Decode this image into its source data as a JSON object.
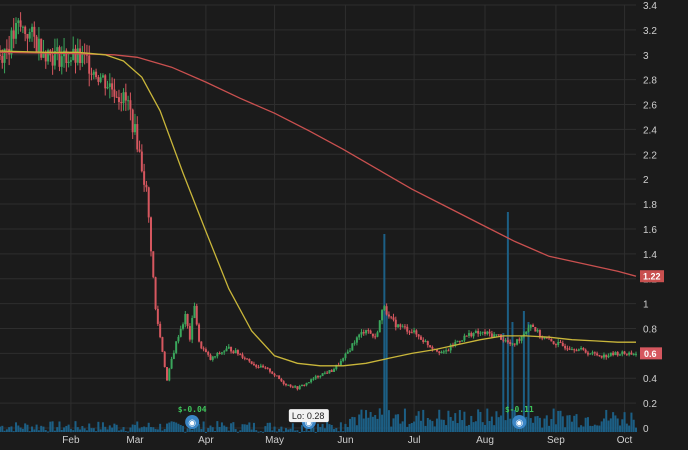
{
  "chart_data": {
    "type": "candlestick",
    "title": "",
    "xlabel": "",
    "ylabel": "",
    "ylim": [
      0,
      3.4
    ],
    "y_ticks": [
      0,
      0.2,
      0.4,
      0.6,
      0.8,
      1,
      1.2,
      1.4,
      1.6,
      1.8,
      2,
      2.2,
      2.4,
      2.6,
      2.8,
      3,
      3.2,
      3.4
    ],
    "x_range_days": [
      0,
      278
    ],
    "month_labels": [
      {
        "label": "Feb",
        "day": 31
      },
      {
        "label": "Mar",
        "day": 59
      },
      {
        "label": "Apr",
        "day": 90
      },
      {
        "label": "May",
        "day": 120
      },
      {
        "label": "Jun",
        "day": 151
      },
      {
        "label": "Jul",
        "day": 181
      },
      {
        "label": "Aug",
        "day": 212
      },
      {
        "label": "Sep",
        "day": 243
      },
      {
        "label": "Oct",
        "day": 273
      }
    ],
    "close_anchors": [
      [
        0,
        3.0
      ],
      [
        4,
        3.08
      ],
      [
        8,
        3.22
      ],
      [
        12,
        3.18
      ],
      [
        16,
        3.1
      ],
      [
        22,
        3.0
      ],
      [
        30,
        2.98
      ],
      [
        38,
        2.95
      ],
      [
        44,
        2.82
      ],
      [
        50,
        2.72
      ],
      [
        56,
        2.6
      ],
      [
        60,
        2.3
      ],
      [
        64,
        1.9
      ],
      [
        66,
        1.45
      ],
      [
        68,
        0.95
      ],
      [
        71,
        0.62
      ],
      [
        73,
        0.38
      ],
      [
        75,
        0.55
      ],
      [
        78,
        0.75
      ],
      [
        81,
        0.9
      ],
      [
        83,
        0.72
      ],
      [
        85,
        1.0
      ],
      [
        87,
        0.68
      ],
      [
        92,
        0.55
      ],
      [
        96,
        0.6
      ],
      [
        100,
        0.64
      ],
      [
        106,
        0.58
      ],
      [
        112,
        0.5
      ],
      [
        118,
        0.46
      ],
      [
        124,
        0.36
      ],
      [
        130,
        0.32
      ],
      [
        134,
        0.36
      ],
      [
        140,
        0.43
      ],
      [
        145,
        0.46
      ],
      [
        150,
        0.55
      ],
      [
        155,
        0.7
      ],
      [
        160,
        0.8
      ],
      [
        164,
        0.72
      ],
      [
        168,
        1.0
      ],
      [
        170,
        0.88
      ],
      [
        174,
        0.82
      ],
      [
        180,
        0.78
      ],
      [
        188,
        0.66
      ],
      [
        194,
        0.6
      ],
      [
        200,
        0.7
      ],
      [
        206,
        0.76
      ],
      [
        212,
        0.76
      ],
      [
        218,
        0.74
      ],
      [
        224,
        0.66
      ],
      [
        228,
        0.74
      ],
      [
        232,
        0.84
      ],
      [
        236,
        0.74
      ],
      [
        240,
        0.7
      ],
      [
        246,
        0.66
      ],
      [
        252,
        0.64
      ],
      [
        258,
        0.6
      ],
      [
        264,
        0.58
      ],
      [
        270,
        0.6
      ],
      [
        278,
        0.6
      ]
    ],
    "ma_short": [
      [
        0,
        3.03
      ],
      [
        20,
        3.02
      ],
      [
        34,
        3.02
      ],
      [
        46,
        3.0
      ],
      [
        54,
        2.95
      ],
      [
        62,
        2.82
      ],
      [
        70,
        2.55
      ],
      [
        80,
        2.05
      ],
      [
        90,
        1.58
      ],
      [
        100,
        1.12
      ],
      [
        110,
        0.78
      ],
      [
        120,
        0.58
      ],
      [
        130,
        0.52
      ],
      [
        140,
        0.5
      ],
      [
        150,
        0.5
      ],
      [
        160,
        0.52
      ],
      [
        170,
        0.56
      ],
      [
        180,
        0.6
      ],
      [
        190,
        0.63
      ],
      [
        200,
        0.67
      ],
      [
        210,
        0.71
      ],
      [
        220,
        0.74
      ],
      [
        230,
        0.74
      ],
      [
        240,
        0.73
      ],
      [
        250,
        0.71
      ],
      [
        260,
        0.7
      ],
      [
        270,
        0.69
      ],
      [
        278,
        0.69
      ]
    ],
    "ma_long": [
      [
        0,
        3.02
      ],
      [
        30,
        3.01
      ],
      [
        50,
        3.0
      ],
      [
        60,
        2.98
      ],
      [
        75,
        2.9
      ],
      [
        90,
        2.78
      ],
      [
        105,
        2.65
      ],
      [
        120,
        2.53
      ],
      [
        135,
        2.39
      ],
      [
        150,
        2.24
      ],
      [
        165,
        2.08
      ],
      [
        180,
        1.92
      ],
      [
        195,
        1.78
      ],
      [
        210,
        1.64
      ],
      [
        225,
        1.5
      ],
      [
        240,
        1.38
      ],
      [
        255,
        1.32
      ],
      [
        270,
        1.26
      ],
      [
        278,
        1.22
      ]
    ],
    "volume_spikes": [
      {
        "day": 168,
        "height": 0.9
      },
      {
        "day": 169,
        "height": 0.55
      },
      {
        "day": 220,
        "height": 0.45
      },
      {
        "day": 222,
        "height": 1.0
      },
      {
        "day": 224,
        "height": 0.5
      },
      {
        "day": 229,
        "height": 0.55
      },
      {
        "day": 231,
        "height": 0.5
      }
    ],
    "last_price_long_ma": "1.22",
    "last_price": "0.6",
    "low_callout": "Lo: 0.28",
    "low_callout_value": 0.28,
    "earnings": [
      {
        "day": 84,
        "label": "$-0.04"
      },
      {
        "day": 135,
        "label": ""
      },
      {
        "day": 227,
        "label": "$-0.11"
      }
    ],
    "colors": {
      "background": "#1b1b1b",
      "grid": "#2e2e2e",
      "up": "#3aa75c",
      "down": "#d6575f",
      "volume": "#1c5f85",
      "ma_short": "#c9b63a",
      "ma_long": "#c9504f",
      "earnings_badge": "#3b86c6"
    }
  }
}
